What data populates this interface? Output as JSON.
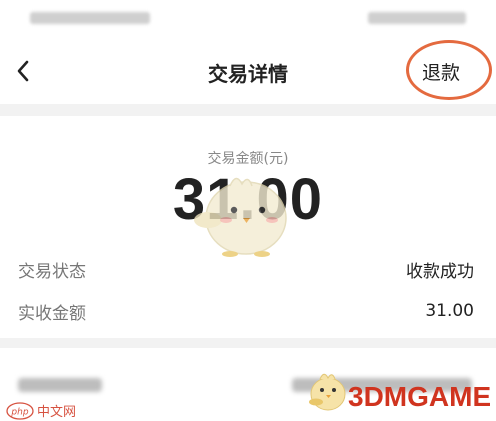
{
  "header": {
    "title": "交易详情",
    "refund_label": "退款"
  },
  "summary": {
    "amount_label": "交易金额(元)",
    "amount_value": "31.00"
  },
  "details": [
    {
      "label": "交易状态",
      "value": "收款成功"
    },
    {
      "label": "实收金额",
      "value": "31.00"
    }
  ],
  "watermarks": {
    "php_site": "php 中文网",
    "game_site": "3DMGAME"
  },
  "colors": {
    "highlight_circle": "#e46a3f",
    "watermark_red": "#d0341f"
  },
  "icons": {
    "back": "chevron-left-icon"
  }
}
